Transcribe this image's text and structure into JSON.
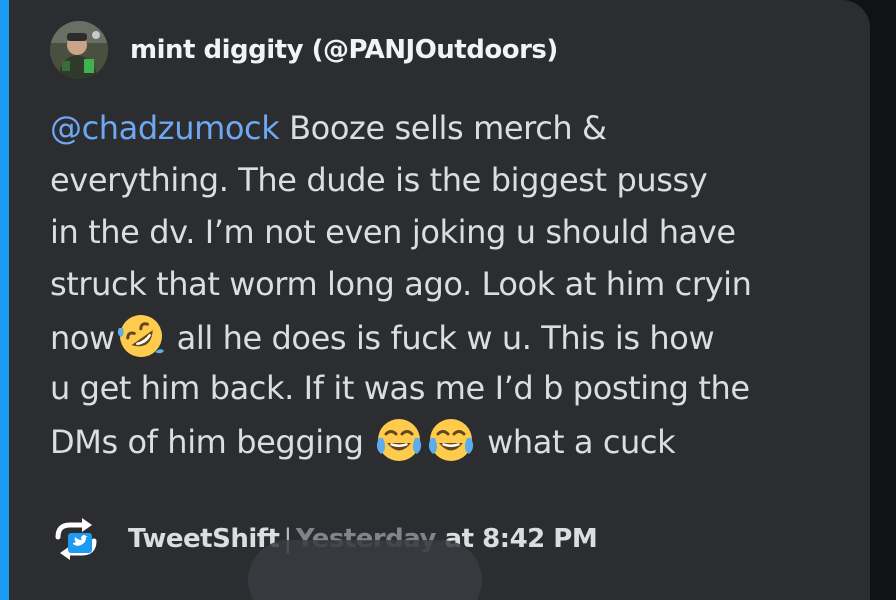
{
  "embed": {
    "accent_color": "#1d9bf0",
    "author": {
      "name": "mint diggity (@PANJOutdoors)",
      "avatar_icon": "user-avatar"
    },
    "description": {
      "mention": "@chadzumock",
      "line1_rest": " Booze sells merch &",
      "line2": "everything. The dude is the biggest pussy",
      "line3": "in the dv. I’m not even joking u should have",
      "line4": "struck that worm long ago. Look at him cryin",
      "line5_before": "now",
      "line5_emoji": "rolling-on-floor-laughing-emoji",
      "line5_after": " all he does is fuck w u. This is how",
      "line6": "u get him back. If it was me I’d b posting the",
      "line7_before": "DMs of him begging ",
      "line7_emojis": [
        "face-with-tears-of-joy-emoji",
        "face-with-tears-of-joy-emoji"
      ],
      "line7_after": " what a cuck"
    },
    "footer": {
      "icon": "tweetshift-icon",
      "source": "TweetShift",
      "separator": "|",
      "day": "Yesterday",
      "time": " at 8:42 PM"
    }
  }
}
